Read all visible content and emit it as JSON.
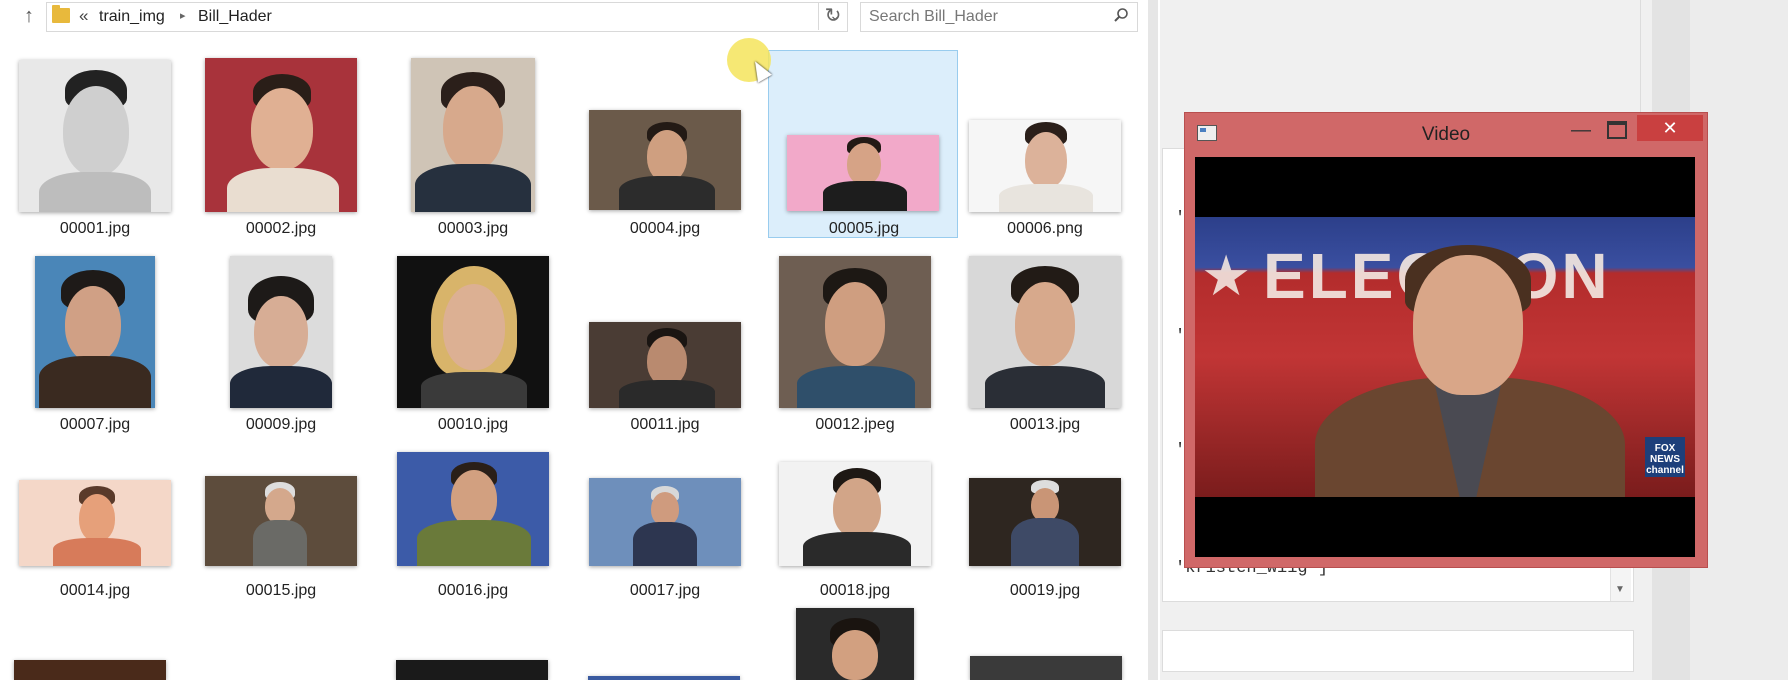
{
  "explorer": {
    "breadcrumb": {
      "lead": "«",
      "parent": "train_img",
      "separator": "▸",
      "current": "Bill_Hader"
    },
    "search_placeholder": "Search Bill_Hader",
    "files": [
      "00001.jpg",
      "00002.jpg",
      "00003.jpg",
      "00004.jpg",
      "00005.jpg",
      "00006.png",
      "00007.jpg",
      "00009.jpg",
      "00010.jpg",
      "00011.jpg",
      "00012.jpeg",
      "00013.jpg",
      "00014.jpg",
      "00015.jpg",
      "00016.jpg",
      "00017.jpg",
      "00018.jpg",
      "00019.jpg"
    ],
    "selected_file": "00005.jpg"
  },
  "right_pane": {
    "code_lines": [
      "'",
      "'",
      "'",
      "'kristen_wiig']"
    ]
  },
  "video_window": {
    "title": "Video",
    "minimize_label": "—",
    "close_label": "✕",
    "banner_text": "ELECTION",
    "logo_text": "FOX NEWS channel"
  },
  "colors": {
    "video_window_frame": "#d06868",
    "selection_bg": "#dceefb",
    "close_button": "#c94040"
  }
}
